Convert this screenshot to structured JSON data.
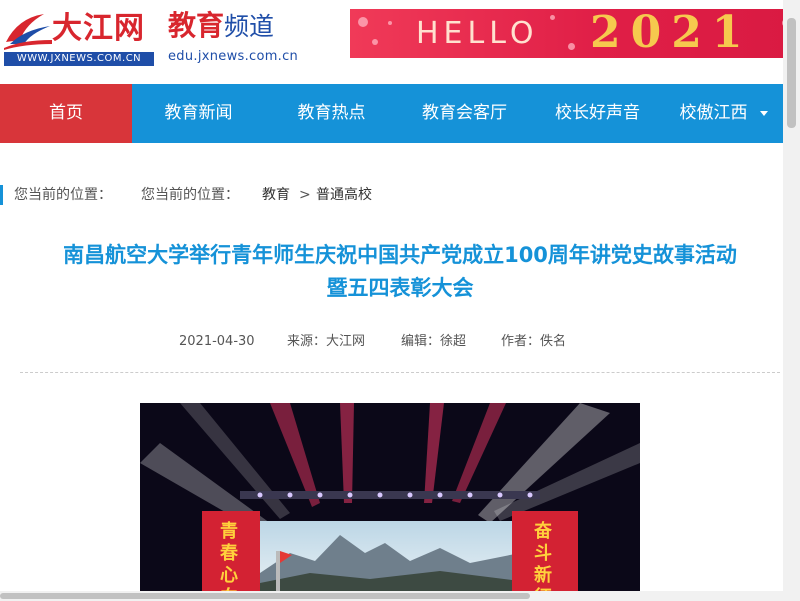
{
  "header": {
    "logo_name": "大江网",
    "logo_url": "WWW.JXNEWS.COM.CN",
    "channel_part1": "教育",
    "channel_part2": "频道",
    "channel_url": "edu.jxnews.com.cn",
    "banner_hello": "HELLO",
    "banner_year": "2021"
  },
  "nav": {
    "items": [
      {
        "label": "首页"
      },
      {
        "label": "教育新闻"
      },
      {
        "label": "教育热点"
      },
      {
        "label": "教育会客厅"
      },
      {
        "label": "校长好声音"
      },
      {
        "label": "校傲江西"
      }
    ]
  },
  "breadcrumb": {
    "label1": "您当前的位置：",
    "label2": "您当前的位置：",
    "crumb1": "教育",
    "separator": ">",
    "crumb2": "普通高校"
  },
  "article": {
    "title_line1": "南昌航空大学举行青年师生庆祝中国共产党成立100周年讲党史故事活动",
    "title_line2": "暨五四表彰大会",
    "date": "2021-04-30",
    "source": "来源：大江网",
    "editor": "编辑：徐超",
    "author": "作者：佚名"
  },
  "photo": {
    "left_banner": "青春心向",
    "right_banner": "奋斗新征"
  },
  "colors": {
    "nav_bg": "#1592d8",
    "nav_active": "#d8353a",
    "title": "#1592d8",
    "brand_red": "#d8262e",
    "brand_blue": "#1f4ea8"
  }
}
